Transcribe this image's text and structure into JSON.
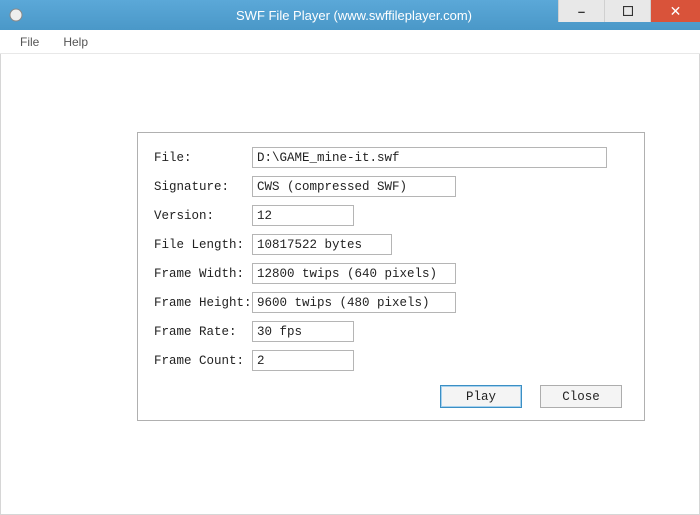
{
  "window": {
    "title": "SWF File Player (www.swffileplayer.com)"
  },
  "menu": {
    "file": "File",
    "help": "Help"
  },
  "labels": {
    "file": "File:",
    "signature": "Signature:",
    "version": "Version:",
    "fileLength": "File Length:",
    "frameWidth": "Frame Width:",
    "frameHeight": "Frame Height:",
    "frameRate": "Frame Rate:",
    "frameCount": "Frame Count:"
  },
  "values": {
    "file": "D:\\GAME_mine-it.swf",
    "signature": "CWS (compressed SWF)",
    "version": "12",
    "fileLength": "10817522 bytes",
    "frameWidth": "12800 twips (640 pixels)",
    "frameHeight": "9600 twips (480 pixels)",
    "frameRate": "30 fps",
    "frameCount": "2"
  },
  "buttons": {
    "play": "Play",
    "close": "Close"
  }
}
